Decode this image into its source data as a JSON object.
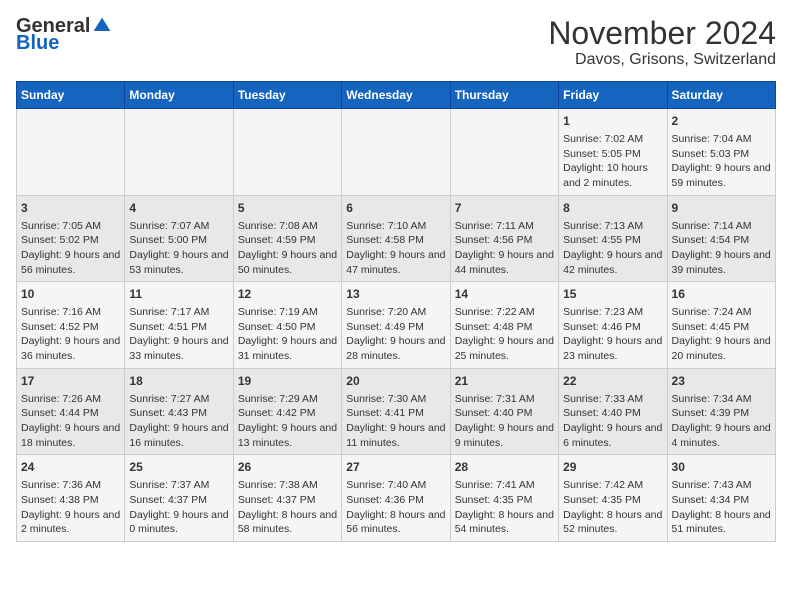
{
  "logo": {
    "general": "General",
    "blue": "Blue"
  },
  "title": "November 2024",
  "location": "Davos, Grisons, Switzerland",
  "days_of_week": [
    "Sunday",
    "Monday",
    "Tuesday",
    "Wednesday",
    "Thursday",
    "Friday",
    "Saturday"
  ],
  "weeks": [
    [
      {
        "day": "",
        "info": ""
      },
      {
        "day": "",
        "info": ""
      },
      {
        "day": "",
        "info": ""
      },
      {
        "day": "",
        "info": ""
      },
      {
        "day": "",
        "info": ""
      },
      {
        "day": "1",
        "info": "Sunrise: 7:02 AM\nSunset: 5:05 PM\nDaylight: 10 hours and 2 minutes."
      },
      {
        "day": "2",
        "info": "Sunrise: 7:04 AM\nSunset: 5:03 PM\nDaylight: 9 hours and 59 minutes."
      }
    ],
    [
      {
        "day": "3",
        "info": "Sunrise: 7:05 AM\nSunset: 5:02 PM\nDaylight: 9 hours and 56 minutes."
      },
      {
        "day": "4",
        "info": "Sunrise: 7:07 AM\nSunset: 5:00 PM\nDaylight: 9 hours and 53 minutes."
      },
      {
        "day": "5",
        "info": "Sunrise: 7:08 AM\nSunset: 4:59 PM\nDaylight: 9 hours and 50 minutes."
      },
      {
        "day": "6",
        "info": "Sunrise: 7:10 AM\nSunset: 4:58 PM\nDaylight: 9 hours and 47 minutes."
      },
      {
        "day": "7",
        "info": "Sunrise: 7:11 AM\nSunset: 4:56 PM\nDaylight: 9 hours and 44 minutes."
      },
      {
        "day": "8",
        "info": "Sunrise: 7:13 AM\nSunset: 4:55 PM\nDaylight: 9 hours and 42 minutes."
      },
      {
        "day": "9",
        "info": "Sunrise: 7:14 AM\nSunset: 4:54 PM\nDaylight: 9 hours and 39 minutes."
      }
    ],
    [
      {
        "day": "10",
        "info": "Sunrise: 7:16 AM\nSunset: 4:52 PM\nDaylight: 9 hours and 36 minutes."
      },
      {
        "day": "11",
        "info": "Sunrise: 7:17 AM\nSunset: 4:51 PM\nDaylight: 9 hours and 33 minutes."
      },
      {
        "day": "12",
        "info": "Sunrise: 7:19 AM\nSunset: 4:50 PM\nDaylight: 9 hours and 31 minutes."
      },
      {
        "day": "13",
        "info": "Sunrise: 7:20 AM\nSunset: 4:49 PM\nDaylight: 9 hours and 28 minutes."
      },
      {
        "day": "14",
        "info": "Sunrise: 7:22 AM\nSunset: 4:48 PM\nDaylight: 9 hours and 25 minutes."
      },
      {
        "day": "15",
        "info": "Sunrise: 7:23 AM\nSunset: 4:46 PM\nDaylight: 9 hours and 23 minutes."
      },
      {
        "day": "16",
        "info": "Sunrise: 7:24 AM\nSunset: 4:45 PM\nDaylight: 9 hours and 20 minutes."
      }
    ],
    [
      {
        "day": "17",
        "info": "Sunrise: 7:26 AM\nSunset: 4:44 PM\nDaylight: 9 hours and 18 minutes."
      },
      {
        "day": "18",
        "info": "Sunrise: 7:27 AM\nSunset: 4:43 PM\nDaylight: 9 hours and 16 minutes."
      },
      {
        "day": "19",
        "info": "Sunrise: 7:29 AM\nSunset: 4:42 PM\nDaylight: 9 hours and 13 minutes."
      },
      {
        "day": "20",
        "info": "Sunrise: 7:30 AM\nSunset: 4:41 PM\nDaylight: 9 hours and 11 minutes."
      },
      {
        "day": "21",
        "info": "Sunrise: 7:31 AM\nSunset: 4:40 PM\nDaylight: 9 hours and 9 minutes."
      },
      {
        "day": "22",
        "info": "Sunrise: 7:33 AM\nSunset: 4:40 PM\nDaylight: 9 hours and 6 minutes."
      },
      {
        "day": "23",
        "info": "Sunrise: 7:34 AM\nSunset: 4:39 PM\nDaylight: 9 hours and 4 minutes."
      }
    ],
    [
      {
        "day": "24",
        "info": "Sunrise: 7:36 AM\nSunset: 4:38 PM\nDaylight: 9 hours and 2 minutes."
      },
      {
        "day": "25",
        "info": "Sunrise: 7:37 AM\nSunset: 4:37 PM\nDaylight: 9 hours and 0 minutes."
      },
      {
        "day": "26",
        "info": "Sunrise: 7:38 AM\nSunset: 4:37 PM\nDaylight: 8 hours and 58 minutes."
      },
      {
        "day": "27",
        "info": "Sunrise: 7:40 AM\nSunset: 4:36 PM\nDaylight: 8 hours and 56 minutes."
      },
      {
        "day": "28",
        "info": "Sunrise: 7:41 AM\nSunset: 4:35 PM\nDaylight: 8 hours and 54 minutes."
      },
      {
        "day": "29",
        "info": "Sunrise: 7:42 AM\nSunset: 4:35 PM\nDaylight: 8 hours and 52 minutes."
      },
      {
        "day": "30",
        "info": "Sunrise: 7:43 AM\nSunset: 4:34 PM\nDaylight: 8 hours and 51 minutes."
      }
    ]
  ]
}
